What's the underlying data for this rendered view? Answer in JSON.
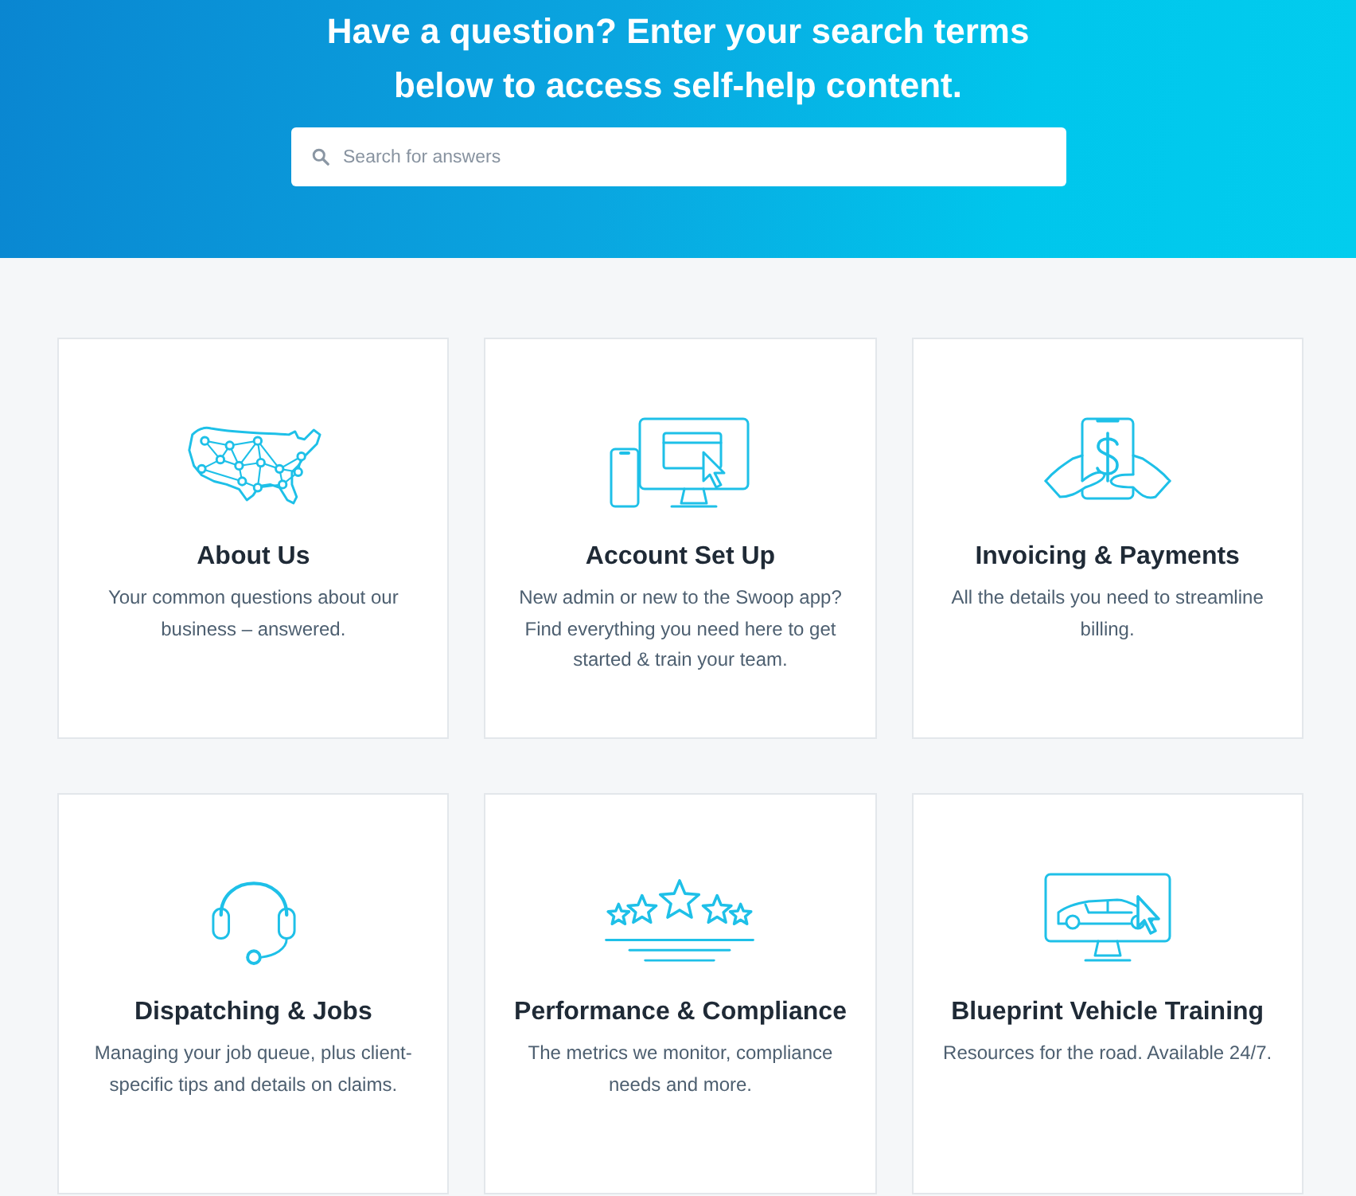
{
  "hero": {
    "title": "Have a question? Enter your search terms below to access self-help content.",
    "search": {
      "placeholder": "Search for answers"
    }
  },
  "categories": [
    {
      "kind": "map",
      "title": "About Us",
      "description": "Your common questions about our business – answered."
    },
    {
      "kind": "devices",
      "title": "Account Set Up",
      "description": "New admin or new to the Swoop app? Find everything you need here to get started & train your team."
    },
    {
      "kind": "payment",
      "title": "Invoicing & Payments",
      "description": "All the details you need to streamline billing."
    },
    {
      "kind": "headset",
      "title": "Dispatching & Jobs",
      "description": "Managing your job queue, plus client-specific tips and details on claims."
    },
    {
      "kind": "rating",
      "title": "Performance & Compliance",
      "description": "The metrics we monitor, compliance needs and more."
    },
    {
      "kind": "vehicle",
      "title": "Blueprint Vehicle Training",
      "description": "Resources for the road. Available 24/7."
    }
  ]
}
